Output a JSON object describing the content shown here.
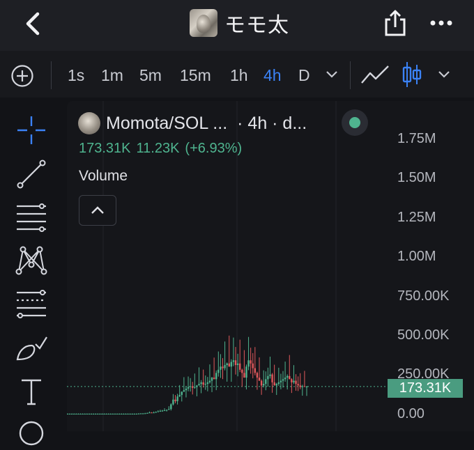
{
  "header": {
    "title": "モモ太",
    "back_icon": "chevron-left-icon",
    "share_icon": "share-icon",
    "more_icon": "more-horizontal-icon"
  },
  "toolbar": {
    "timeframes": [
      "1s",
      "1m",
      "5m",
      "15m",
      "1h",
      "4h",
      "D"
    ],
    "active_timeframe": "4h"
  },
  "sidebar": {
    "tools": [
      "crosshair-icon",
      "trend-line-icon",
      "horizontal-lines-icon",
      "pattern-icon",
      "fib-levels-icon",
      "brush-icon",
      "text-tool-icon",
      "shape-icon"
    ]
  },
  "chart": {
    "symbol": "Momota/SOL ...",
    "interval": "· 4h · d...",
    "price": "173.31K",
    "change": "11.23K",
    "change_pct": "(+6.93%)",
    "indicator_label": "Volume",
    "last_price_tag": "173.31K",
    "accent_up": "#4fb48f",
    "accent_down": "#e2595c"
  },
  "chart_data": {
    "type": "candlestick",
    "yaxis_ticks": [
      "1.75M",
      "1.50M",
      "1.25M",
      "1.00M",
      "750.00K",
      "500.00K",
      "250.00K",
      "0.00"
    ],
    "ylim": [
      0,
      1750000
    ],
    "last_value": 173310,
    "series": [
      {
        "values": [
          0,
          0,
          0,
          0,
          0,
          0,
          0,
          0,
          0,
          0,
          0,
          0,
          0,
          0,
          0,
          0,
          0,
          0,
          0,
          0,
          0,
          0,
          0,
          0,
          0,
          0,
          0,
          0,
          0,
          0,
          0,
          0,
          0,
          1,
          2,
          2,
          3,
          5,
          8,
          6,
          8,
          12,
          15,
          18,
          20,
          22,
          25,
          30,
          60,
          90,
          80,
          110,
          120,
          140,
          150,
          160,
          170,
          175,
          165,
          170,
          180,
          190,
          200,
          185,
          190,
          200,
          210,
          230,
          220,
          260,
          280,
          300,
          290,
          310,
          320,
          300,
          330,
          340,
          310,
          320,
          280,
          260,
          230,
          300,
          340,
          320,
          290,
          260,
          230,
          210,
          180,
          190,
          220,
          240,
          250,
          200,
          180,
          190,
          200,
          210,
          220,
          230,
          240,
          220,
          200,
          210,
          190,
          180,
          170,
          175,
          172,
          173
        ]
      }
    ]
  }
}
